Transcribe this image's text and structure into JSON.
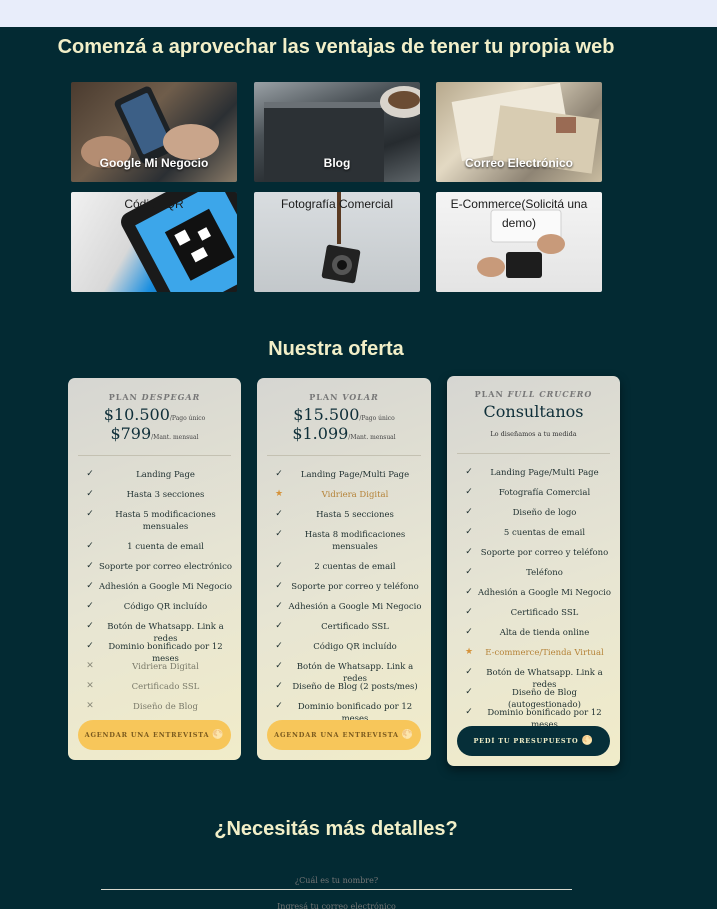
{
  "header": {
    "title": "Comenzá a aprovechar las ventajas de tener tu propia web"
  },
  "services": [
    {
      "label": "Google Mi Negocio"
    },
    {
      "label": "Blog"
    },
    {
      "label": "Correo Electrónico"
    },
    {
      "label": "Código QR"
    },
    {
      "label": "Fotografía Comercial"
    },
    {
      "label": "E-Commerce(Solicitá una demo)"
    }
  ],
  "offer": {
    "title": "Nuestra oferta",
    "plans": [
      {
        "plan_prefix": "PLAN ",
        "plan_name": "DESPEGAR",
        "price1": "$10.500",
        "price1_note": "/Pago único",
        "price2": "$799",
        "price2_note": "/Mant. mensual",
        "features": [
          {
            "text": "Landing Page",
            "icon": "check"
          },
          {
            "text": "Hasta 3 secciones",
            "icon": "check"
          },
          {
            "text": "Hasta 5 modificaciones mensuales",
            "icon": "check"
          },
          {
            "text": "1 cuenta de email",
            "icon": "check"
          },
          {
            "text": "Soporte por correo electrónico",
            "icon": "check"
          },
          {
            "text": "Adhesión a Google Mi Negocio",
            "icon": "check"
          },
          {
            "text": "Código QR incluído",
            "icon": "check"
          },
          {
            "text": "Botón de Whatsapp. Link a redes",
            "icon": "check"
          },
          {
            "text": "Dominio bonificado por 12 meses",
            "icon": "check"
          },
          {
            "text": "Vidriera Digital",
            "icon": "cross"
          },
          {
            "text": "Certificado SSL",
            "icon": "cross"
          },
          {
            "text": "Diseño de Blog",
            "icon": "cross"
          }
        ],
        "button": "AGENDAR UNA ENTREVISTA"
      },
      {
        "plan_prefix": "PLAN ",
        "plan_name": "VOLAR",
        "price1": "$15.500",
        "price1_note": "/Pago único",
        "price2": "$1.099",
        "price2_note": "/Mant. mensual",
        "features": [
          {
            "text": "Landing Page/Multi Page",
            "icon": "check"
          },
          {
            "text": "Vidriera Digital",
            "icon": "star"
          },
          {
            "text": "Hasta 5 secciones",
            "icon": "check"
          },
          {
            "text": "Hasta 8 modificaciones mensuales",
            "icon": "check"
          },
          {
            "text": "2 cuentas de email",
            "icon": "check"
          },
          {
            "text": "Soporte por correo y teléfono",
            "icon": "check"
          },
          {
            "text": "Adhesión a Google Mi Negocio",
            "icon": "check"
          },
          {
            "text": "Certificado SSL",
            "icon": "check"
          },
          {
            "text": "Código QR incluído",
            "icon": "check"
          },
          {
            "text": "Botón de Whatsapp. Link a redes",
            "icon": "check"
          },
          {
            "text": "Diseño de Blog (2 posts/mes)",
            "icon": "check"
          },
          {
            "text": "Dominio bonificado por 12 meses",
            "icon": "check"
          }
        ],
        "button": "AGENDAR UNA ENTREVISTA"
      },
      {
        "plan_prefix": "PLAN ",
        "plan_name": "FULL CRUCERO",
        "headline": "Consultanos",
        "sub": "Lo diseñamos a tu medida",
        "features": [
          {
            "text": "Landing Page/Multi Page",
            "icon": "check"
          },
          {
            "text": "Fotografía Comercial",
            "icon": "check"
          },
          {
            "text": "Diseño de logo",
            "icon": "check"
          },
          {
            "text": "5 cuentas de email",
            "icon": "check"
          },
          {
            "text": "Soporte por correo y teléfono",
            "icon": "check"
          },
          {
            "text": "Teléfono",
            "icon": "check"
          },
          {
            "text": "Adhesión a Google Mi Negocio",
            "icon": "check"
          },
          {
            "text": "Certificado SSL",
            "icon": "check"
          },
          {
            "text": "Alta de tienda online",
            "icon": "check"
          },
          {
            "text": "E-commerce/Tienda Virtual",
            "icon": "star"
          },
          {
            "text": "Botón de Whatsapp. Link a redes",
            "icon": "check"
          },
          {
            "text": "Diseño de Blog (autogestionado)",
            "icon": "check"
          },
          {
            "text": "Dominio bonificado por 12 meses",
            "icon": "check"
          }
        ],
        "button": "PEDÍ TU PRESUPUESTO"
      }
    ]
  },
  "contact": {
    "title": "¿Necesitás más detalles?",
    "name_placeholder": "¿Cuál es tu nombre?",
    "email_placeholder": "Ingresá tu correo electrónico"
  },
  "colors": {
    "background": "#032a33",
    "accent_yellow": "#f7c65a",
    "heading": "#f2efc8",
    "star": "#d5923a"
  }
}
